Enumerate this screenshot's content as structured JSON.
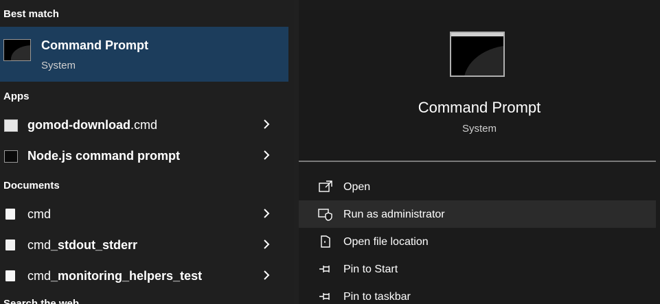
{
  "sections": {
    "best_match": "Best match",
    "apps": "Apps",
    "documents": "Documents",
    "search_web": "Search the web"
  },
  "best_match": {
    "title": "Command Prompt",
    "subtitle": "System"
  },
  "apps": [
    {
      "bold": "gomod-download",
      "normal": ".cmd"
    },
    {
      "bold": "Node.js command prompt",
      "normal": ""
    }
  ],
  "documents": [
    {
      "normal": "cmd",
      "bold": ""
    },
    {
      "normal": "cmd",
      "bold": "_stdout_stderr"
    },
    {
      "normal": "cmd",
      "bold": "_monitoring_helpers_test"
    }
  ],
  "detail": {
    "title": "Command Prompt",
    "subtitle": "System"
  },
  "actions": [
    {
      "label": "Open",
      "icon": "open-icon"
    },
    {
      "label": "Run as administrator",
      "icon": "shield-icon"
    },
    {
      "label": "Open file location",
      "icon": "folder-icon"
    },
    {
      "label": "Pin to Start",
      "icon": "pin-icon"
    },
    {
      "label": "Pin to taskbar",
      "icon": "pin-icon"
    }
  ]
}
